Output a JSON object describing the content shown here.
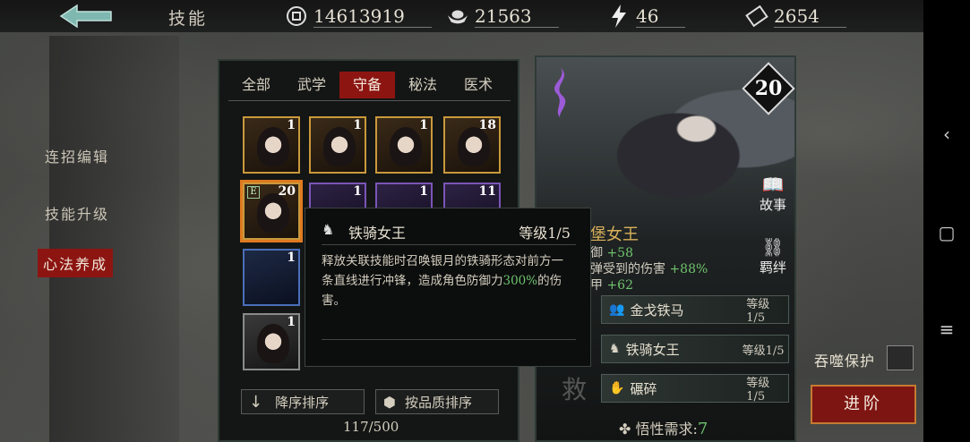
{
  "header": {
    "title": "技能",
    "resources": [
      {
        "icon": "coin-icon",
        "value": "14613919"
      },
      {
        "icon": "ingot-icon",
        "value": "21563"
      },
      {
        "icon": "energy-icon",
        "value": "46"
      },
      {
        "icon": "ticket-icon",
        "value": "2654"
      }
    ]
  },
  "left_menu": {
    "items": [
      "连招编辑",
      "技能升级",
      "心法养成"
    ],
    "active_index": 2
  },
  "skill_list": {
    "tabs": [
      "全部",
      "武学",
      "守备",
      "秘法",
      "医术"
    ],
    "active_tab": 2,
    "slots": [
      {
        "count": "1",
        "rarity": "gold"
      },
      {
        "count": "1",
        "rarity": "gold"
      },
      {
        "count": "1",
        "rarity": "gold"
      },
      {
        "count": "18",
        "rarity": "gold"
      },
      {
        "count": "20",
        "rarity": "gold",
        "badge": "E",
        "selected": true
      },
      {
        "count": "1",
        "rarity": "purple"
      },
      {
        "count": "1",
        "rarity": "purple"
      },
      {
        "count": "11",
        "rarity": "purple"
      },
      {
        "count": "1",
        "rarity": "blue"
      },
      {
        "count": "1",
        "rarity": "grey"
      }
    ],
    "sort_desc_label": "降序排序",
    "sort_quality_label": "按品质排序",
    "capacity": "117/500"
  },
  "character": {
    "level": "20",
    "name_partial": "堡女王",
    "links": {
      "story": "故事",
      "bond": "羁绊"
    },
    "stats": [
      {
        "label": "御",
        "value": "+58"
      },
      {
        "label": "弹受到的伤害",
        "value": "+88%"
      },
      {
        "label": "甲",
        "value": "+62"
      }
    ],
    "skills": [
      {
        "name": "金戈铁马",
        "level": "等级1/5"
      },
      {
        "name": "铁骑女王",
        "level": "等级1/5"
      },
      {
        "name": "碾碎",
        "level": "等级1/5"
      }
    ],
    "wuxing_label": "悟性需求:",
    "wuxing_value": "7",
    "side_glyph": "救"
  },
  "tooltip": {
    "name": "铁骑女王",
    "level": "等级1/5",
    "desc_prefix": "释放关联技能时召唤银月的铁骑形态对前方一条直线进行冲锋，造成角色防御力",
    "desc_highlight": "300%",
    "desc_suffix": "的伤害。"
  },
  "controls": {
    "protect_label": "吞噬保护",
    "advance_label": "进阶"
  },
  "colors": {
    "accent_red": "#8c1512",
    "gold_border": "#c9993c",
    "green_value": "#6fc46f"
  }
}
